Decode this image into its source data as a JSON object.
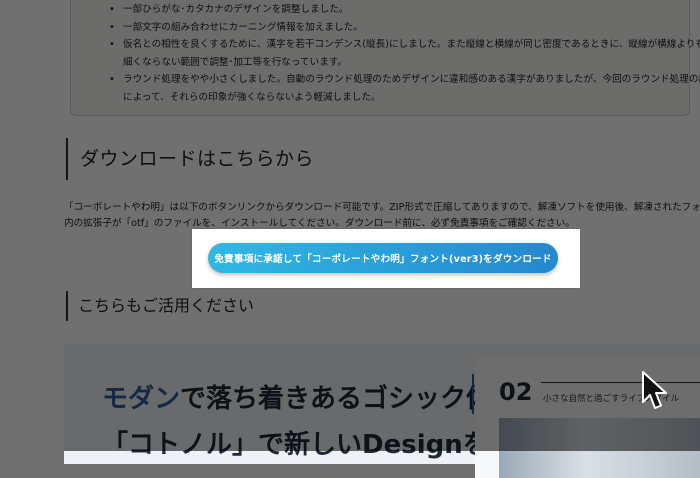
{
  "notes": {
    "items": [
      "一部ひらがな･カタカナのデザインを調整しました。",
      "一部文字の組み合わせにカーニング情報を加えました。",
      "仮名との相性を良くするために、漢字を若干コンデンス(縦長)にしました。また縦線と横線が同じ密度であるときに、縦線が横線よりも",
      "細くならない範囲で調整･加工等を行なっています。",
      "ラウンド処理をやや小さくしました。自動のラウンド処理のためデザインに違和感のある漢字がありましたが、今回のラウンド処理の調整",
      "によって、それらの印象が強くならないよう軽減しました。"
    ]
  },
  "download": {
    "heading": "ダウンロードはこちらから",
    "desc_line1": "「コーポレートやわ明」は以下のボタンリンクからダウンロード可能です。ZIP形式で圧縮してありますので、解凍ソフトを使用後、解凍されたフォルダー",
    "desc_line2": "内の拡張子が「otf」のファイルを、インストールしてください。ダウンロード前に、必ず免責事項をご確認ください。",
    "button_label": "免責事項に承諾して「コーポレートやわ明」フォント(ver3)をダウンロード"
  },
  "related": {
    "heading": "こちらもご活用ください",
    "banner_line1_accent": "モダン",
    "banner_line1_rest": "で落ち着きあるゴシック体",
    "banner_line2": "「コトノル」で新しいDesignを",
    "card_number": "02",
    "card_text": "小さな自然と過ごすライフスタイル"
  },
  "colors": {
    "button_start": "#2fb8e3",
    "button_end": "#2687cf",
    "accent": "#2e5f9f"
  }
}
